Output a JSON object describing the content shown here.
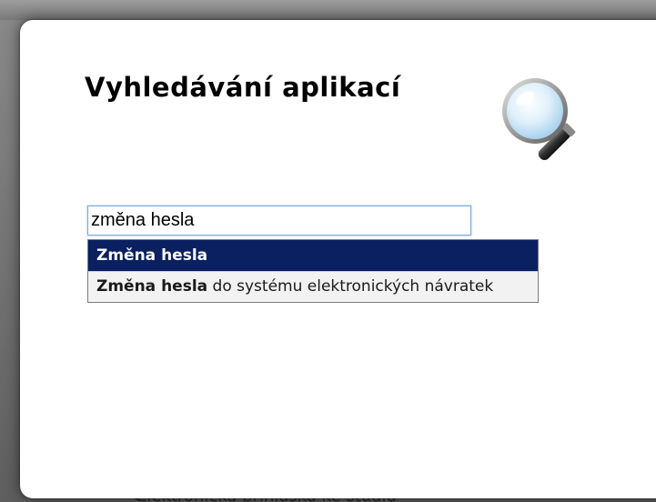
{
  "modal": {
    "title": "Vyhledávání aplikací"
  },
  "search": {
    "value": "změna hesla"
  },
  "suggestions": [
    {
      "match": "Změna hesla",
      "rest": ""
    },
    {
      "match": "Změna hesla",
      "rest": " do systému elektronických návratek"
    }
  ],
  "background": {
    "partial_text": "Elektronicka prihlaska ke studiu"
  },
  "colors": {
    "highlight": "#0a2061",
    "input_border": "#7aa6e6"
  }
}
